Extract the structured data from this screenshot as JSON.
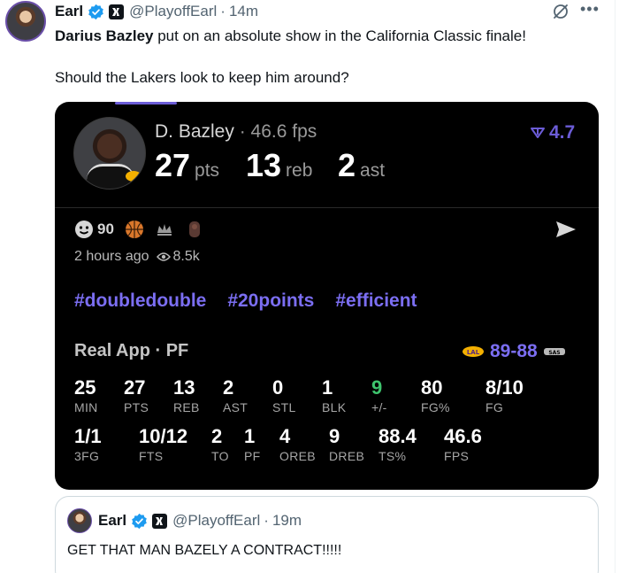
{
  "post": {
    "author_name": "Earl",
    "handle": "@PlayoffEarl",
    "separator": "·",
    "time": "14m",
    "text_bold": "Darius Bazley",
    "text_rest": " put on an absolute show in the California Classic finale!",
    "text_line2": "Should the Lakers look to keep him around?"
  },
  "card": {
    "player_name": "D. Bazley",
    "player_fps": "· 46.6 fps",
    "headline_stats": [
      {
        "value": "27",
        "unit": "pts"
      },
      {
        "value": "13",
        "unit": "reb"
      },
      {
        "value": "2",
        "unit": "ast"
      }
    ],
    "rating": "4.7",
    "reactions_count": "90",
    "posted": "2 hours ago",
    "views": "8.5k",
    "hashtags": [
      "#doubledouble",
      "#20points",
      "#efficient"
    ],
    "source": "Real App · PF",
    "score": "89-88",
    "stats_row1": [
      {
        "value": "25",
        "label": "MIN"
      },
      {
        "value": "27",
        "label": "PTS"
      },
      {
        "value": "13",
        "label": "REB"
      },
      {
        "value": "2",
        "label": "AST"
      },
      {
        "value": "0",
        "label": "STL"
      },
      {
        "value": "1",
        "label": "BLK"
      },
      {
        "value": "9",
        "label": "+/-"
      },
      {
        "value": "80",
        "label": "FG%"
      },
      {
        "value": "8/10",
        "label": "FG"
      }
    ],
    "stats_row2": [
      {
        "value": "1/1",
        "label": "3FG"
      },
      {
        "value": "10/12",
        "label": "FTS"
      },
      {
        "value": "2",
        "label": "TO"
      },
      {
        "value": "1",
        "label": "PF"
      },
      {
        "value": "4",
        "label": "OREB"
      },
      {
        "value": "9",
        "label": "DREB"
      },
      {
        "value": "88.4",
        "label": "TS%"
      },
      {
        "value": "46.6",
        "label": "FPS"
      }
    ]
  },
  "quote": {
    "author_name": "Earl",
    "handle": "@PlayoffEarl",
    "separator": "·",
    "time": "19m",
    "text": "GET THAT MAN BAZELY A CONTRACT!!!!!"
  },
  "colors": {
    "accent_purple": "#7b6ef2",
    "plus_minus_green": "#3ec46d",
    "verified_blue": "#1d9bf0"
  },
  "icons": [
    "verified-badge-icon",
    "affiliate-badge-icon",
    "grok-icon",
    "more-icon",
    "rating-arrow-icon",
    "emoji-icon",
    "basketball-icon",
    "crown-icon",
    "share-icon",
    "eye-icon",
    "lakers-logo-icon",
    "spurs-logo-icon"
  ]
}
